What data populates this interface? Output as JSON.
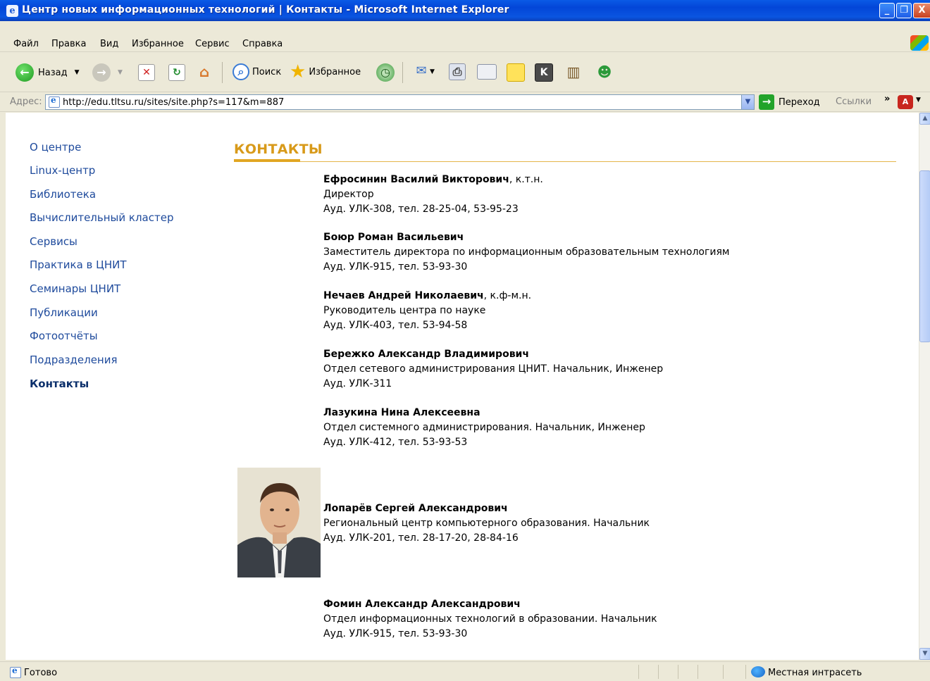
{
  "window": {
    "title": "Центр новых информационных технологий | Контакты - Microsoft Internet Explorer",
    "buttons": [
      "_",
      "❐",
      "X"
    ]
  },
  "menu": [
    "Файл",
    "Правка",
    "Вид",
    "Избранное",
    "Сервис",
    "Справка"
  ],
  "toolbar": {
    "back_label": "Назад",
    "search_label": "Поиск",
    "favorites_label": "Избранное"
  },
  "address_bar": {
    "label": "Адрес:",
    "url": "http://edu.tltsu.ru/sites/site.php?s=117&m=887",
    "go_label": "Переход",
    "links_label": "Ссылки"
  },
  "nav": {
    "items": [
      {
        "label": "О центре",
        "active": false
      },
      {
        "label": "Linux-центр",
        "active": false
      },
      {
        "label": "Библиотека",
        "active": false
      },
      {
        "label": "Вычислительный кластер",
        "active": false
      },
      {
        "label": "Сервисы",
        "active": false
      },
      {
        "label": "Практика в ЦНИТ",
        "active": false
      },
      {
        "label": "Семинары ЦНИТ",
        "active": false
      },
      {
        "label": "Публикации",
        "active": false
      },
      {
        "label": "Фотоотчёты",
        "active": false
      },
      {
        "label": "Подразделения",
        "active": false
      },
      {
        "label": "Контакты",
        "active": true
      }
    ]
  },
  "page": {
    "title": "КОНТАКТЫ"
  },
  "contacts": [
    {
      "name": "Ефросинин Василий Викторович",
      "degree": ", к.т.н.",
      "position": "Директор",
      "office": "Ауд. УЛК-308, тел. 28-25-04, 53-95-23"
    },
    {
      "name": "Боюр Роман Васильевич",
      "degree": "",
      "position": "Заместитель директора по информационным образовательным технологиям",
      "office": "Ауд. УЛК-915, тел. 53-93-30"
    },
    {
      "name": "Нечаев Андрей Николаевич",
      "degree": ", к.ф-м.н.",
      "position": "Руководитель центра по науке",
      "office": "Ауд. УЛК-403, тел. 53-94-58"
    },
    {
      "name": "Бережко Александр Владимирович",
      "degree": "",
      "position": "Отдел сетевого администрирования ЦНИТ. Начальник, Инженер",
      "office": "Ауд. УЛК-311"
    },
    {
      "name": "Лазукина Нина Алексеевна",
      "degree": "",
      "position": "Отдел системного администрирования. Начальник, Инженер",
      "office": "Ауд. УЛК-412, тел. 53-93-53"
    },
    {
      "name": "Лопарёв Сергей Александрович",
      "degree": "",
      "position": "Региональный центр компьютерного образования. Начальник",
      "office": "Ауд. УЛК-201, тел. 28-17-20, 28-84-16"
    },
    {
      "name": "Фомин Александр Александрович",
      "degree": "",
      "position": "Отдел информационных технологий в образовании. Начальник",
      "office": "Ауд. УЛК-915, тел. 53-93-30"
    }
  ],
  "status": {
    "text": "Готово",
    "zone": "Местная интрасеть"
  }
}
